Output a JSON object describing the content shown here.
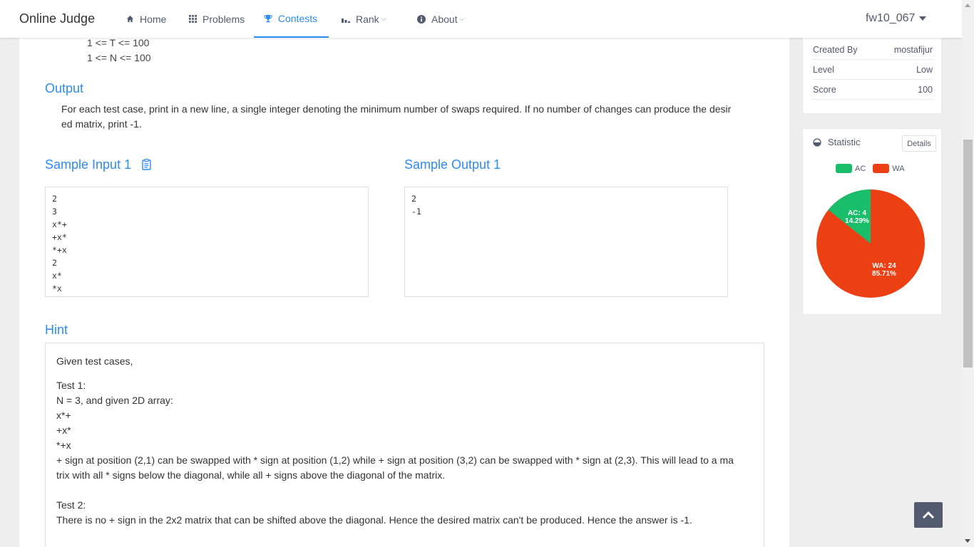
{
  "nav": {
    "brand": "Online Judge",
    "items": [
      {
        "label": "Home",
        "icon": "home-icon"
      },
      {
        "label": "Problems",
        "icon": "grid-icon"
      },
      {
        "label": "Contests",
        "icon": "trophy-icon",
        "active": true
      },
      {
        "label": "Rank",
        "icon": "bar-chart-icon",
        "dropdown": true
      },
      {
        "label": "About",
        "icon": "info-icon",
        "dropdown": true
      }
    ],
    "user": "fw10_067"
  },
  "problem": {
    "constraints": [
      "1 <= T <= 100",
      "1 <= N <= 100"
    ],
    "output_title": "Output",
    "output_text_1": "For each test case, print in a new line, a single integer denoting the minimum number of swaps required. If no number of changes can produce the desir",
    "output_text_2": "ed matrix, print -1.",
    "sample_input_title": "Sample Input 1",
    "sample_output_title": "Sample Output 1",
    "sample_input": [
      "2",
      "3",
      "x*+",
      "+x*",
      "*+x",
      "2",
      "x*",
      "*x"
    ],
    "sample_output": [
      "2",
      "-1"
    ],
    "hint_title": "Hint",
    "hint_lines": [
      "Given test cases,",
      "Test 1:",
      "N = 3, and given 2D array:",
      "x*+",
      "+x*",
      "*+x",
      "+ sign at position (2,1) can be swapped with * sign at position (1,2) while + sign at position (3,2) can be swapped with * sign at (2,3). This will lead to a ma",
      "trix with all * signs below the diagonal, while all + signs above the diagonal of the matrix.",
      "Test 2:",
      "There is no + sign in the 2x2 matrix that can be shifted above the diagonal. Hence the desired matrix can't be produced. Hence the answer is -1."
    ]
  },
  "sidebar": {
    "info": [
      {
        "label": "Created By",
        "value": "mostafijur"
      },
      {
        "label": "Level",
        "value": "Low"
      },
      {
        "label": "Score",
        "value": "100"
      }
    ],
    "statistic_title": "Statistic",
    "details_label": "Details",
    "legend": [
      {
        "label": "AC",
        "color": "#19be6b"
      },
      {
        "label": "WA",
        "color": "#ed3f14"
      }
    ],
    "pie": {
      "ac_label": "AC: 4",
      "ac_pct": "14.29%",
      "wa_label": "WA: 24",
      "wa_pct": "85.71%"
    }
  },
  "colors": {
    "primary": "#2d8cf0",
    "ac": "#19be6b",
    "wa": "#ed3f14"
  }
}
